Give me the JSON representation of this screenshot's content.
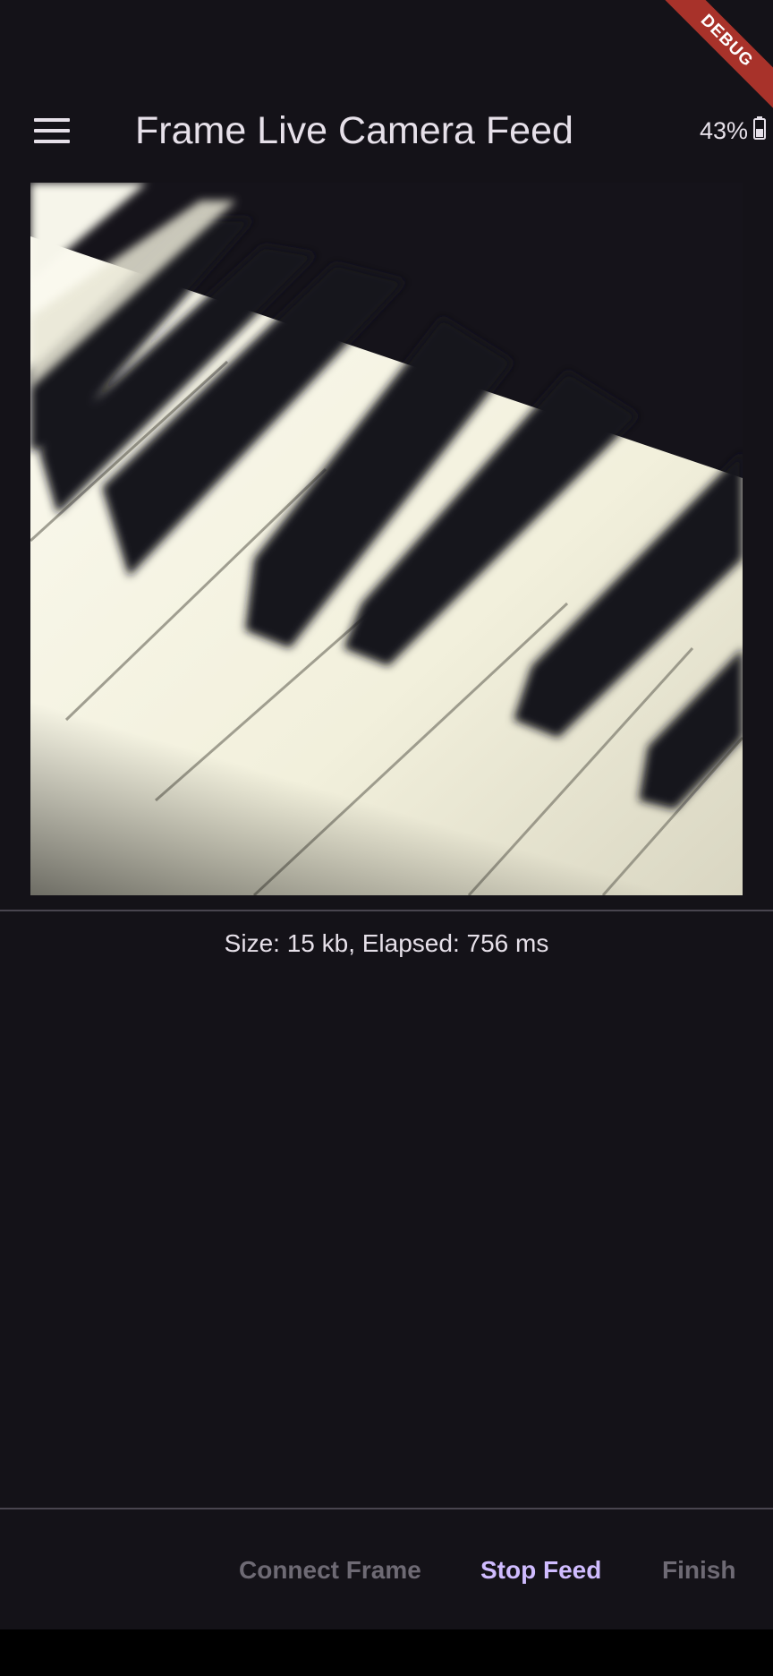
{
  "app_bar": {
    "title": "Frame Live Camera Feed",
    "menu_icon": "hamburger-menu-icon"
  },
  "status_bar": {
    "battery_percent": "43%",
    "battery_icon": "battery-icon"
  },
  "debug_banner": {
    "label": "DEBUG",
    "color": "#a8322a"
  },
  "camera_feed": {
    "image": "piano-keys-photo"
  },
  "status": {
    "text": "Size: 15 kb, Elapsed: 756 ms"
  },
  "actions": {
    "connect_label": "Connect Frame",
    "connect_enabled": false,
    "stop_label": "Stop Feed",
    "stop_enabled": true,
    "finish_label": "Finish",
    "finish_enabled": false
  },
  "colors": {
    "background": "#141218",
    "on_surface": "#e6e0e9",
    "primary": "#d0bcff",
    "disabled": "#6e6a74",
    "divider": "#49454f"
  }
}
